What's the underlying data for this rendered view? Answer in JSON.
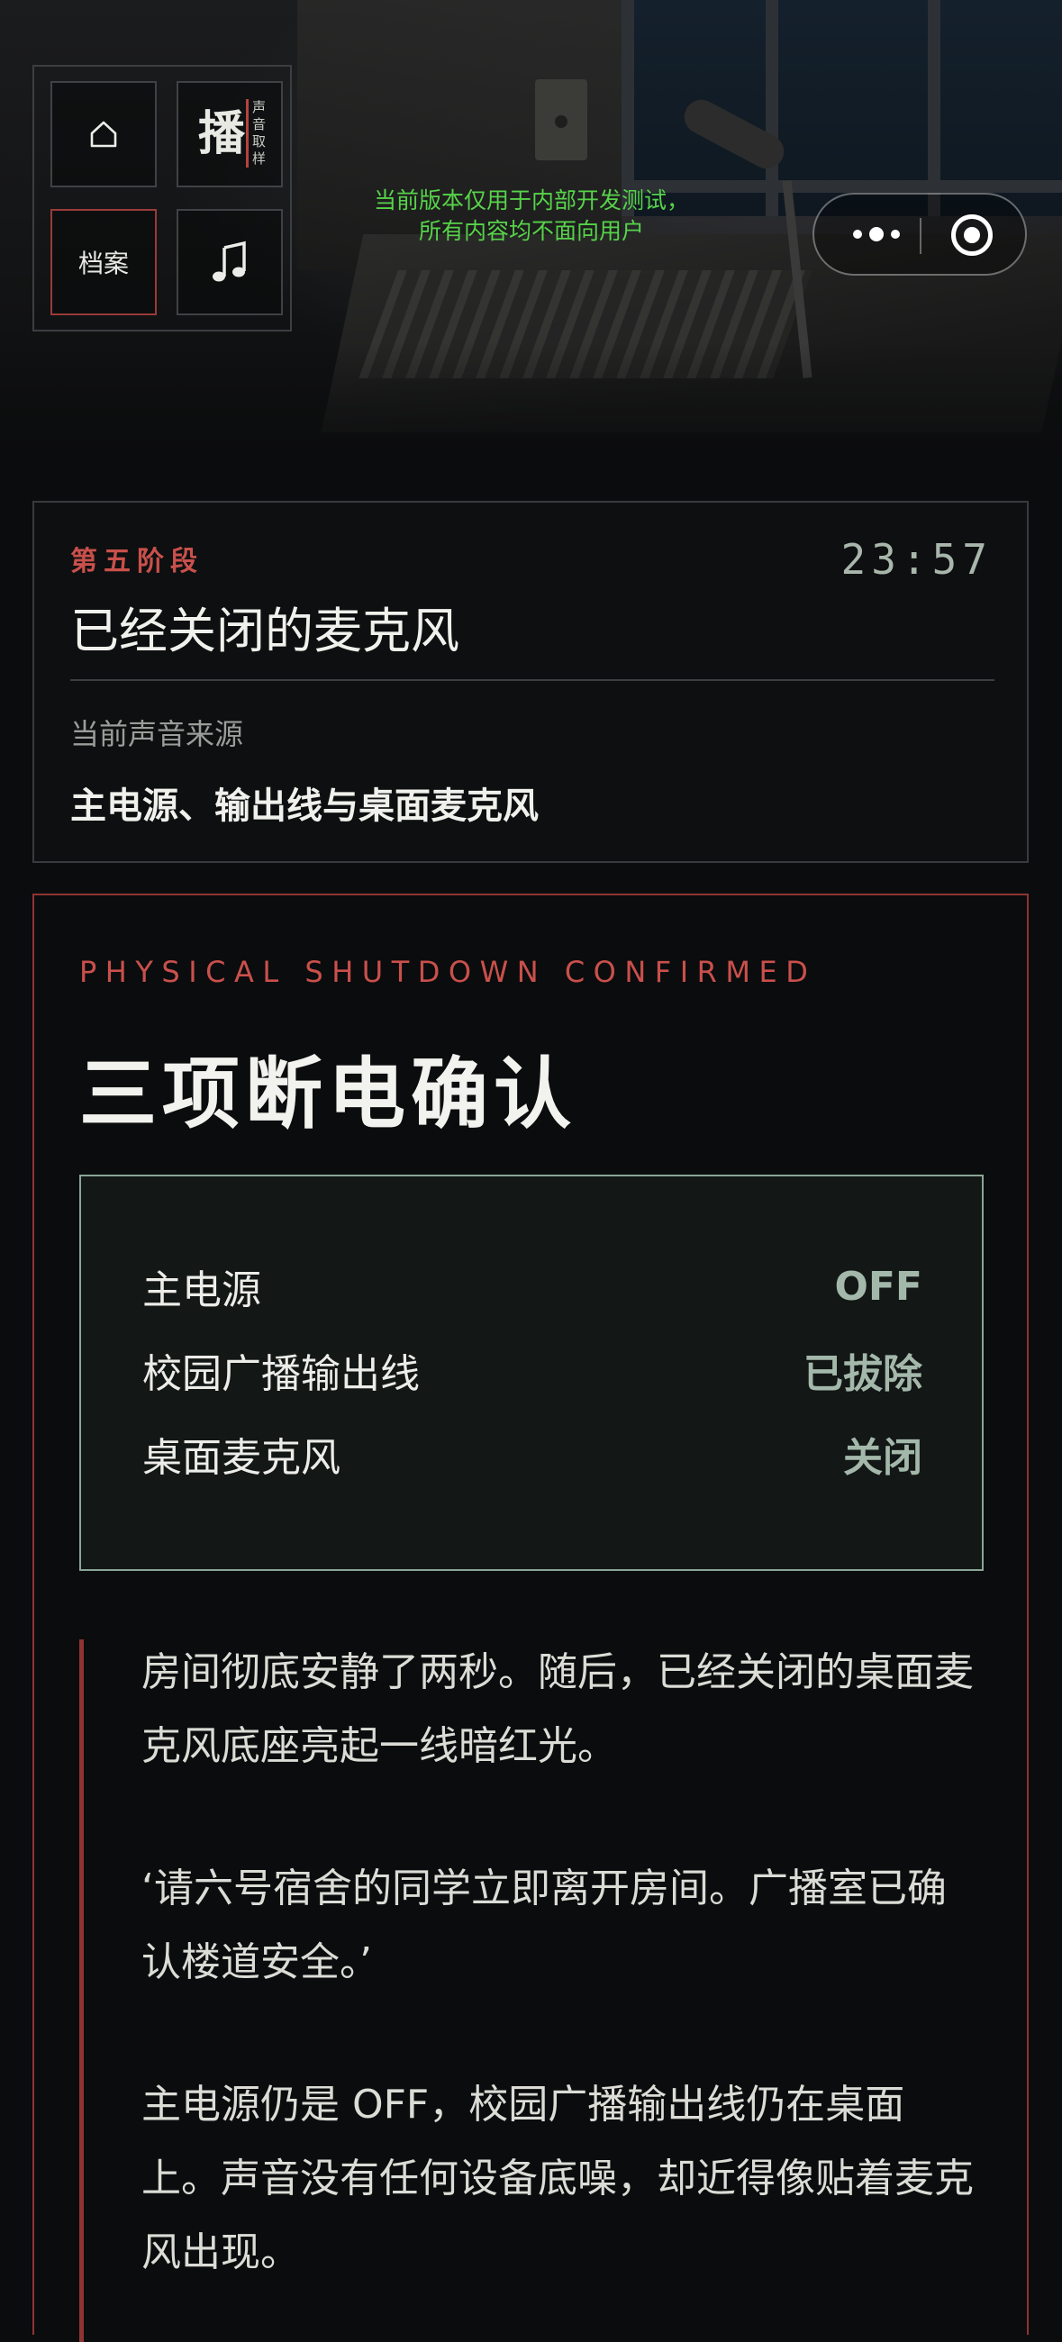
{
  "nav": {
    "home_icon": "home-icon",
    "broadcast_main": "播",
    "broadcast_side": "声音取样",
    "archive_label": "档案",
    "music_icon": "music-note-icon"
  },
  "notice": {
    "line1": "当前版本仅用于内部开发测试，",
    "line2": "所有内容均不面向用户"
  },
  "capsule": {
    "more_icon": "more-dots-icon",
    "close_icon": "close-target-icon"
  },
  "stage": {
    "tag": "第五阶段",
    "time": "23:57",
    "title": "已经关闭的麦克风",
    "source_label": "当前声音来源",
    "source_value": "主电源、输出线与桌面麦克风"
  },
  "confirm": {
    "eyebrow": "PHYSICAL SHUTDOWN CONFIRMED",
    "title": "三项断电确认",
    "rows": [
      {
        "key": "主电源",
        "value": "OFF"
      },
      {
        "key": "校园广播输出线",
        "value": "已拔除"
      },
      {
        "key": "桌面麦克风",
        "value": "关闭"
      }
    ],
    "accent_color": "#8e3433",
    "status_color": "#a3b8aa"
  },
  "story": {
    "p1": "房间彻底安静了两秒。随后，已经关闭的桌面麦克风底座亮起一线暗红光。",
    "p2": "‘请六号宿舍的同学立即离开房间。广播室已确认楼道安全。’",
    "p3": "主电源仍是 OFF，校园广播输出线仍在桌面上。声音没有任何设备底噪，却近得像贴着麦克风出现。"
  }
}
